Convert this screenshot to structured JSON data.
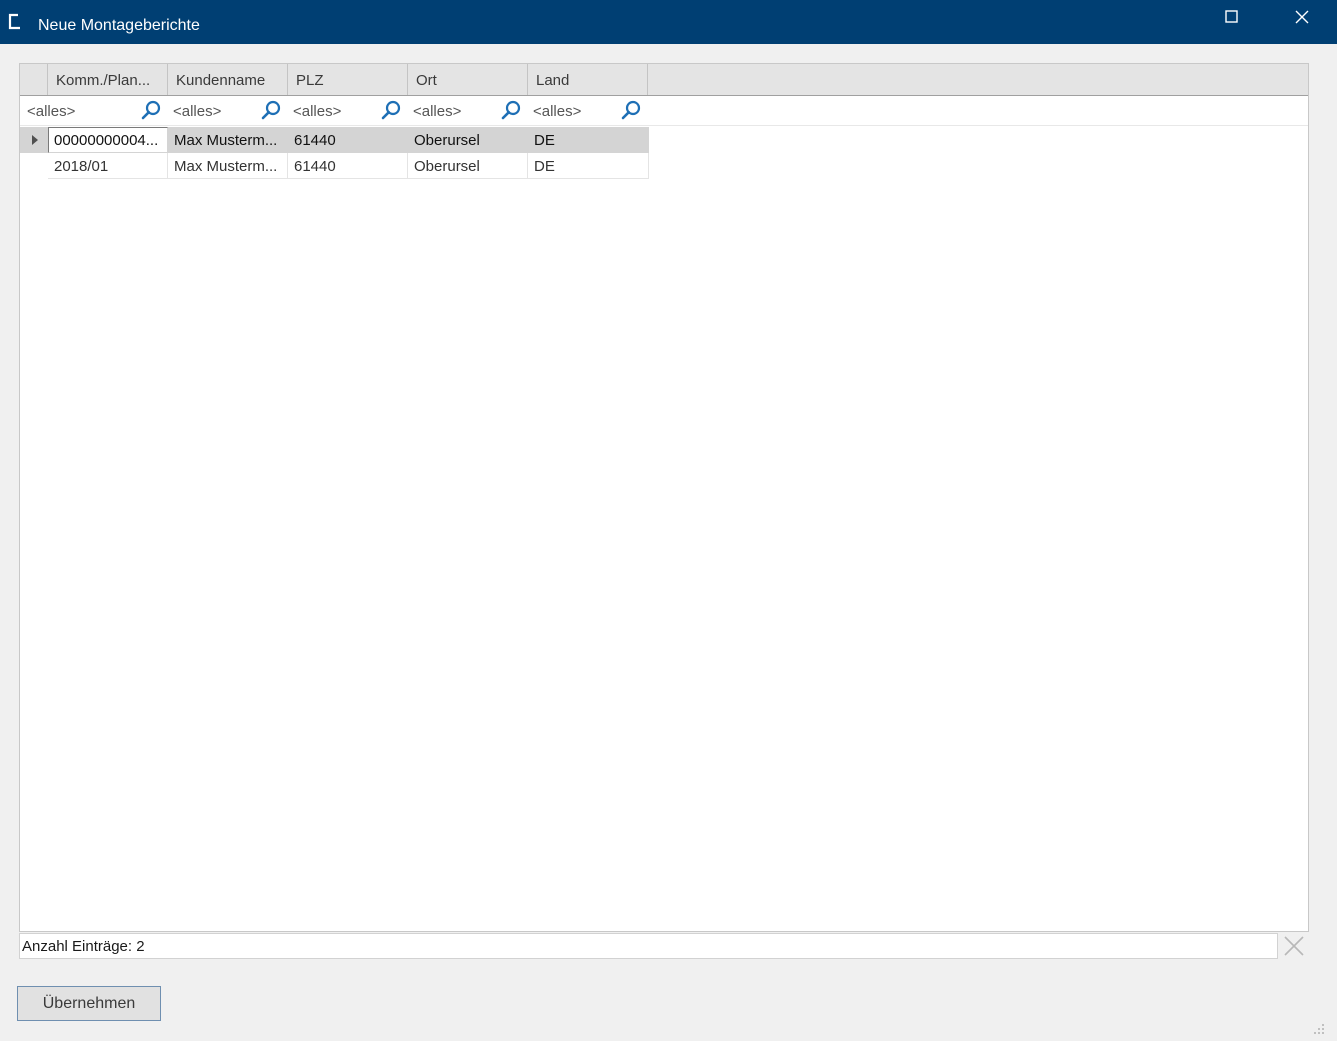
{
  "window": {
    "title": "Neue Montageberichte",
    "icon": "app-logo-icon",
    "controls": [
      "maximize-icon",
      "close-icon"
    ]
  },
  "grid": {
    "columns": [
      {
        "label": "Komm./Plan..."
      },
      {
        "label": "Kundenname"
      },
      {
        "label": "PLZ"
      },
      {
        "label": "Ort"
      },
      {
        "label": "Land"
      }
    ],
    "filters": [
      {
        "placeholder": "<alles>"
      },
      {
        "placeholder": "<alles>"
      },
      {
        "placeholder": "<alles>"
      },
      {
        "placeholder": "<alles>"
      },
      {
        "placeholder": "<alles>"
      }
    ],
    "rows": [
      {
        "selected": true,
        "cells": [
          "00000000004...",
          "Max Musterm...",
          "61440",
          "Oberursel",
          "DE"
        ]
      },
      {
        "selected": false,
        "cells": [
          "2018/01",
          "Max Musterm...",
          "61440",
          "Oberursel",
          "DE"
        ]
      }
    ]
  },
  "status": {
    "count_text": "Anzahl Einträge: 2"
  },
  "actions": {
    "apply_label": "Übernehmen"
  },
  "colors": {
    "titlebar": "#003f73",
    "search_icon": "#1e6fb5",
    "selected_row": "#d4d4d4"
  }
}
